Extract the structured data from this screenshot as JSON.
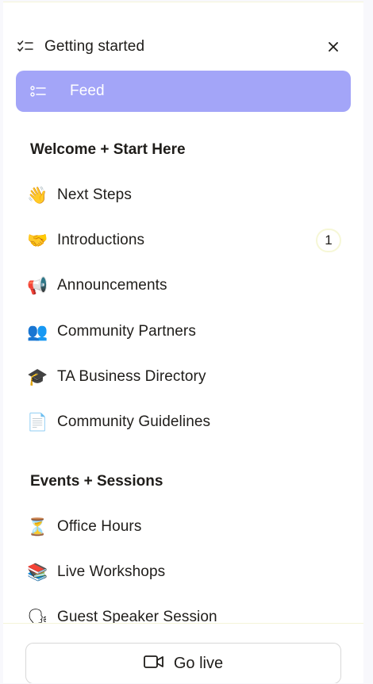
{
  "header": {
    "getting_started_label": "Getting started",
    "close_icon": "close-icon"
  },
  "feed": {
    "label": "Feed",
    "active_color": "#a3a5f8"
  },
  "sections": [
    {
      "title": "Welcome + Start Here",
      "items": [
        {
          "emoji": "👋",
          "label": "Next Steps"
        },
        {
          "emoji": "🤝",
          "label": "Introductions",
          "badge": "1"
        },
        {
          "emoji": "📢",
          "label": "Announcements"
        },
        {
          "emoji": "👥",
          "label": "Community Partners"
        },
        {
          "emoji": "🎓",
          "label": "TA Business Directory"
        },
        {
          "emoji": "📄",
          "label": "Community Guidelines"
        }
      ]
    },
    {
      "title": "Events + Sessions",
      "items": [
        {
          "emoji": "⏳",
          "label": "Office Hours"
        },
        {
          "emoji": "📚",
          "label": "Live Workshops"
        },
        {
          "emoji": "🗣",
          "label": "Guest Speaker Session"
        }
      ]
    }
  ],
  "footer": {
    "go_live_label": "Go live",
    "go_live_icon": "video-camera-icon"
  }
}
